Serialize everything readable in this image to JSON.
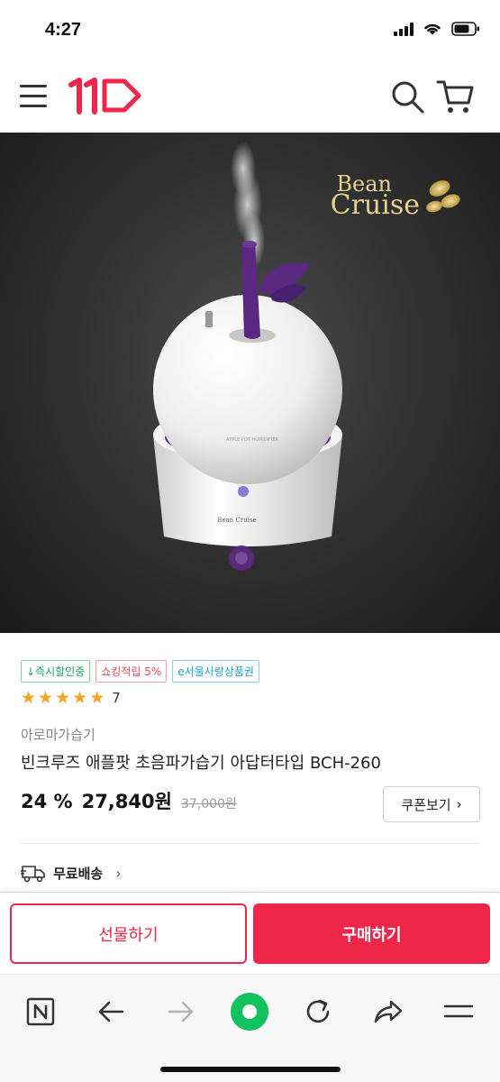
{
  "status_bar": {
    "time": "4:27"
  },
  "header": {
    "logo_text": "11"
  },
  "hero": {
    "brand_line1": "Bean",
    "brand_line2": "Cruise"
  },
  "badges": [
    {
      "label": "↓즉시할인중",
      "color": "#1aa261"
    },
    {
      "label": "쇼킹적립 5%",
      "color": "#e64b5b"
    },
    {
      "label": "e서울사랑상품권",
      "color": "#1b9ec8"
    }
  ],
  "rating": {
    "stars": 5,
    "max_stars": 5,
    "review_count": "7"
  },
  "product": {
    "category": "아로마가습기",
    "title": "빈크루즈 애플팟 초음파가습기 아답터타입 BCH-260",
    "discount": "24 %",
    "price": "27,840원",
    "original_price": "37,000원"
  },
  "coupon_button": {
    "label": "쿠폰보기",
    "chevron": "›"
  },
  "shipping": {
    "label": "무료배송",
    "chevron": "›"
  },
  "actions": {
    "gift_label": "선물하기",
    "buy_label": "구매하기"
  },
  "colors": {
    "brand": "#f0254a",
    "star": "#f4a623",
    "browser_home": "#10c35f"
  },
  "icons": [
    "menu-icon",
    "search-icon",
    "cart-icon",
    "truck-icon",
    "naver-n-icon",
    "back-arrow-icon",
    "forward-arrow-icon",
    "home-circle-icon",
    "refresh-icon",
    "share-icon",
    "menu-lines-icon"
  ]
}
